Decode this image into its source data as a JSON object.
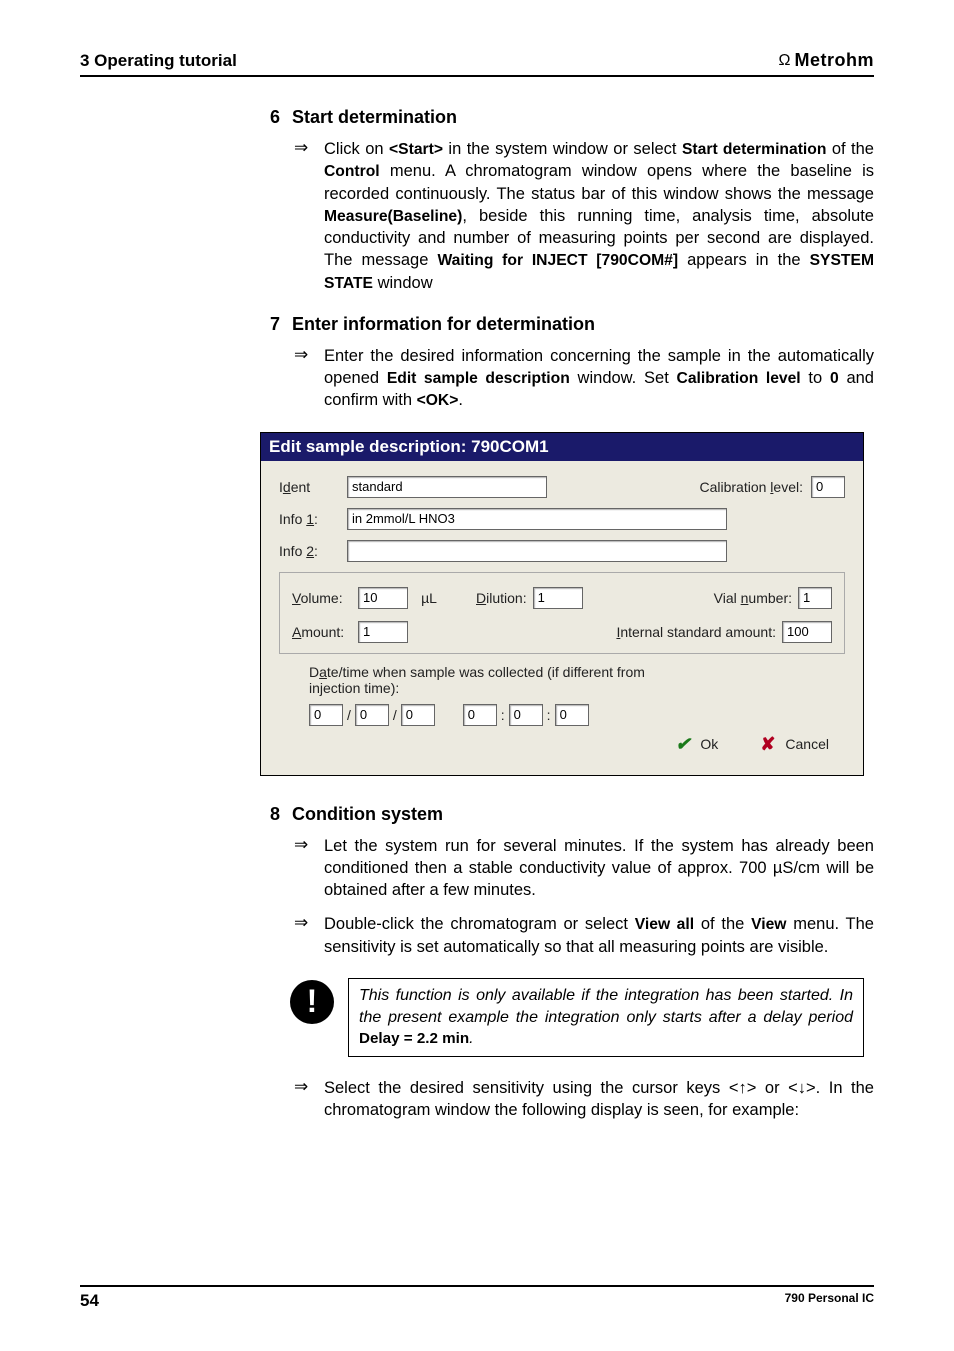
{
  "header": {
    "left": "3 Operating tutorial",
    "brand": "Metrohm"
  },
  "sections": {
    "s6": {
      "num": "6",
      "title": "Start determination",
      "bullet1_pre": "Click on ",
      "bullet1_start": "<Start>",
      "bullet1_mid1": " in the system window or select ",
      "bullet1_startdet": "Start determination",
      "bullet1_mid2": " of the ",
      "bullet1_control": "Control",
      "bullet1_mid3": " menu. A chromatogram window opens where the baseline is recorded continuously. The status bar of this window shows the message ",
      "bullet1_measure": "Measure(Baseline)",
      "bullet1_mid4": ", beside this running time, analysis time, absolute conductivity and number of measuring points per second are displayed. The message ",
      "bullet1_waiting": "Waiting for INJECT [790COM#]",
      "bullet1_mid5": " appears in the ",
      "bullet1_systemstate": "SYSTEM STATE",
      "bullet1_end": " window"
    },
    "s7": {
      "num": "7",
      "title": "Enter information for determination",
      "bullet1_pre": "Enter the desired information concerning the sample in the automatically opened ",
      "bullet1_edit": "Edit sample description",
      "bullet1_mid1": " window. Set ",
      "bullet1_cal": "Calibration level",
      "bullet1_mid2": " to ",
      "bullet1_zero": "0",
      "bullet1_mid3": " and confirm with ",
      "bullet1_ok": "<OK>",
      "bullet1_end": "."
    },
    "s8": {
      "num": "8",
      "title": "Condition system",
      "bullet1": "Let the system run for several minutes. If the system has already been conditioned then a stable conductivity value of approx. 700 µS/cm will be obtained after a few minutes.",
      "bullet2_pre": "Double-click the chromatogram or select ",
      "bullet2_viewall": "View all",
      "bullet2_mid": " of the ",
      "bullet2_view": "View",
      "bullet2_end": " menu. The sensitivity is set automatically so that all measuring points are visible.",
      "bullet3_pre": "Select the desired sensitivity using the cursor keys <",
      "bullet3_mid1": "> or <",
      "bullet3_mid2": ">. In the chromatogram window the following display is seen, for example:"
    }
  },
  "dialog": {
    "title": "Edit sample description: 790COM1",
    "ident_label_pre": "I",
    "ident_label_u": "d",
    "ident_label_post": "ent",
    "ident_value": "standard",
    "caliblevel_pre": "Calibration ",
    "caliblevel_u": "l",
    "caliblevel_post": "evel:",
    "caliblevel_value": "0",
    "info1_pre": "Info ",
    "info1_u": "1",
    "info1_post": ":",
    "info1_value": "in 2mmol/L HNO3",
    "info2_pre": "Info ",
    "info2_u": "2",
    "info2_post": ":",
    "info2_value": "",
    "volume_u": "V",
    "volume_post": "olume:",
    "volume_value": "10",
    "volume_unit": "µL",
    "dilution_u": "D",
    "dilution_post": "ilution:",
    "dilution_value": "1",
    "vial_pre": "Vial ",
    "vial_u": "n",
    "vial_post": "umber:",
    "vial_value": "1",
    "amount_u": "A",
    "amount_post": "mount:",
    "amount_value": "1",
    "intstd_u": "I",
    "intstd_post": "nternal standard amount:",
    "intstd_value": "100",
    "datetime_pre": "D",
    "datetime_u": "a",
    "datetime_post": "te/time when sample was collected (if different from injection time):",
    "dt_d": "0",
    "dt_m": "0",
    "dt_y": "0",
    "dt_hh": "0",
    "dt_mm": "0",
    "dt_ss": "0",
    "ok": "Ok",
    "cancel": "Cancel"
  },
  "note": {
    "text_pre": "This function is only available if the integration has been started. In the present example the integration only starts after a delay period ",
    "delay": "Delay = 2.2 min",
    "text_post": "."
  },
  "footer": {
    "page": "54",
    "right": "790 Personal IC"
  }
}
